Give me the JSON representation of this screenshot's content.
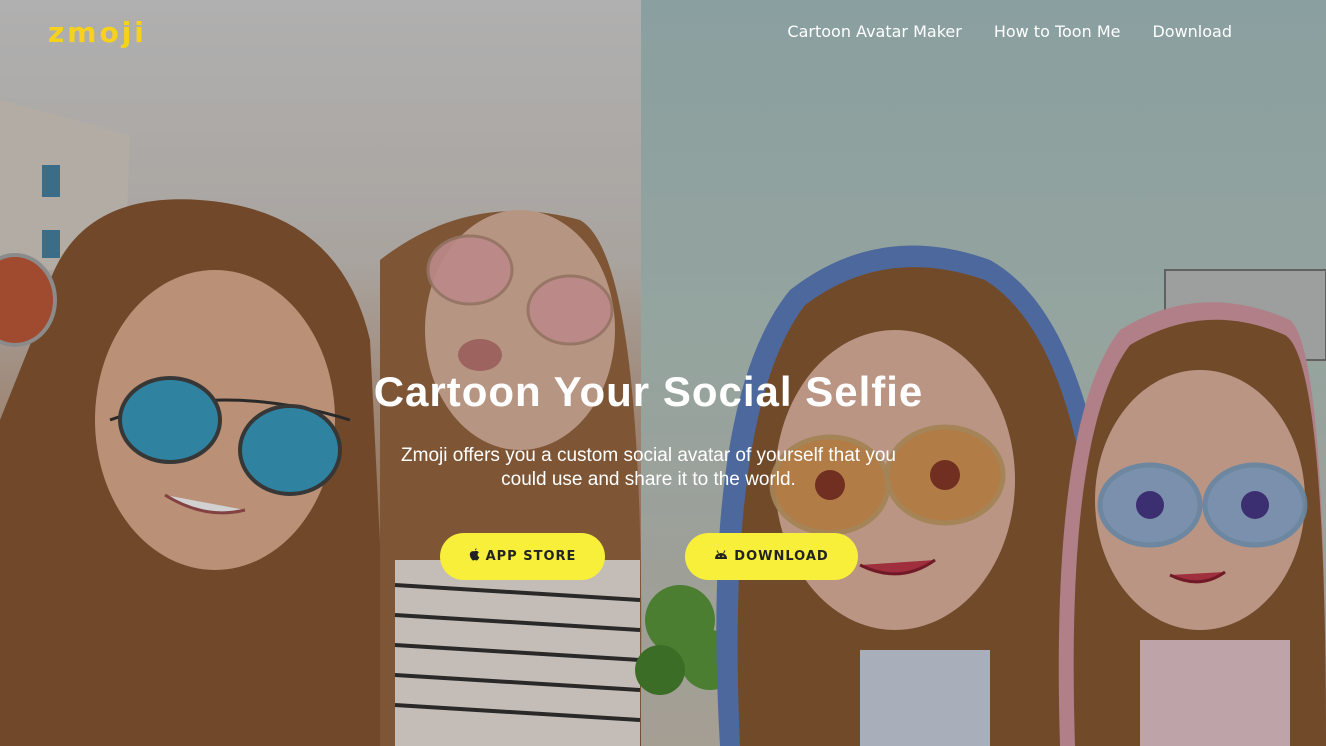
{
  "brand": {
    "logo": "zmoji",
    "accent": "#f7d21c",
    "button_color": "#f7ef3a"
  },
  "nav": [
    {
      "label": "Cartoon Avatar Maker"
    },
    {
      "label": "How to Toon Me"
    },
    {
      "label": "Download"
    }
  ],
  "hero": {
    "title": "Cartoon Your Social Selfie",
    "subtitle": "Zmoji offers you a custom social avatar of yourself that you could use and share it to the world."
  },
  "buttons": {
    "app_store": {
      "label": "APP STORE",
      "icon": "apple-icon"
    },
    "download": {
      "label": "DOWNLOAD",
      "icon": "android-icon"
    }
  }
}
